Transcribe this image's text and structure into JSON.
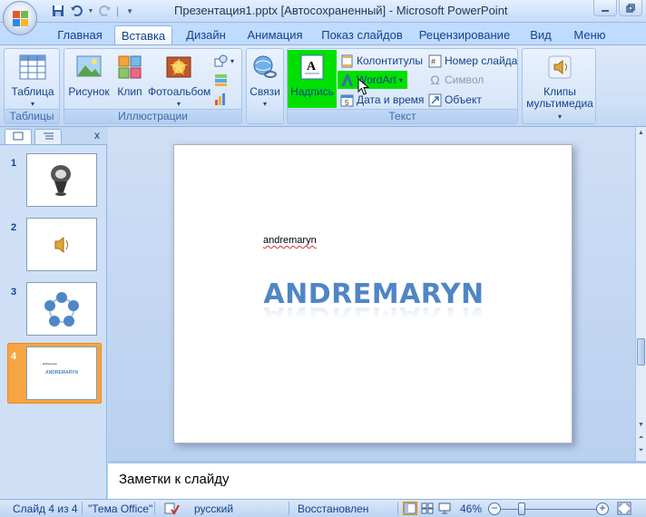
{
  "window": {
    "title": "Презентация1.pptx [Автосохраненный] - Microsoft PowerPoint"
  },
  "tabs": [
    {
      "label": "Главная"
    },
    {
      "label": "Вставка"
    },
    {
      "label": "Дизайн"
    },
    {
      "label": "Анимация"
    },
    {
      "label": "Показ слайдов"
    },
    {
      "label": "Рецензирование"
    },
    {
      "label": "Вид"
    },
    {
      "label": "Меню"
    }
  ],
  "ribbon": {
    "groups": {
      "tables": {
        "label": "Таблицы",
        "buttons": {
          "table": "Таблица"
        }
      },
      "illustrations": {
        "label": "Иллюстрации",
        "buttons": {
          "picture": "Рисунок",
          "clip": "Клип",
          "album": "Фотоальбом"
        }
      },
      "links": {
        "buttons": {
          "links": "Связи"
        }
      },
      "text": {
        "label": "Текст",
        "buttons": {
          "textbox": "Надпись",
          "header_footer": "Колонтитулы",
          "wordart": "WordArt",
          "datetime": "Дата и время",
          "slide_number": "Номер слайда",
          "symbol": "Символ",
          "object": "Объект"
        }
      },
      "media": {
        "buttons": {
          "clips_line1": "Клипы",
          "clips_line2": "мультимедиа"
        }
      }
    },
    "highlight_color": "#00e000"
  },
  "slides_panel": {
    "close": "x",
    "thumbnails": [
      {
        "number": "1",
        "content": "image-icon"
      },
      {
        "number": "2",
        "content": "speaker-icon"
      },
      {
        "number": "3",
        "content": "cycle-diagram-icon"
      },
      {
        "number": "4",
        "content": "text",
        "mini_small": "andremaryn",
        "mini_big": "ANDREMARYN",
        "selected": true
      }
    ]
  },
  "slide": {
    "small_text": "andremaryn",
    "wordart_text": "ANDREMARYN",
    "wordart_color": "#4f86c6"
  },
  "notes": {
    "placeholder": "Заметки к слайду"
  },
  "statusbar": {
    "slide_info": "Слайд 4 из 4",
    "theme": "\"Тема Office\"",
    "language": "русский",
    "restored": "Восстановлен",
    "zoom": "46%",
    "zoom_minus": "−",
    "zoom_plus": "+"
  }
}
